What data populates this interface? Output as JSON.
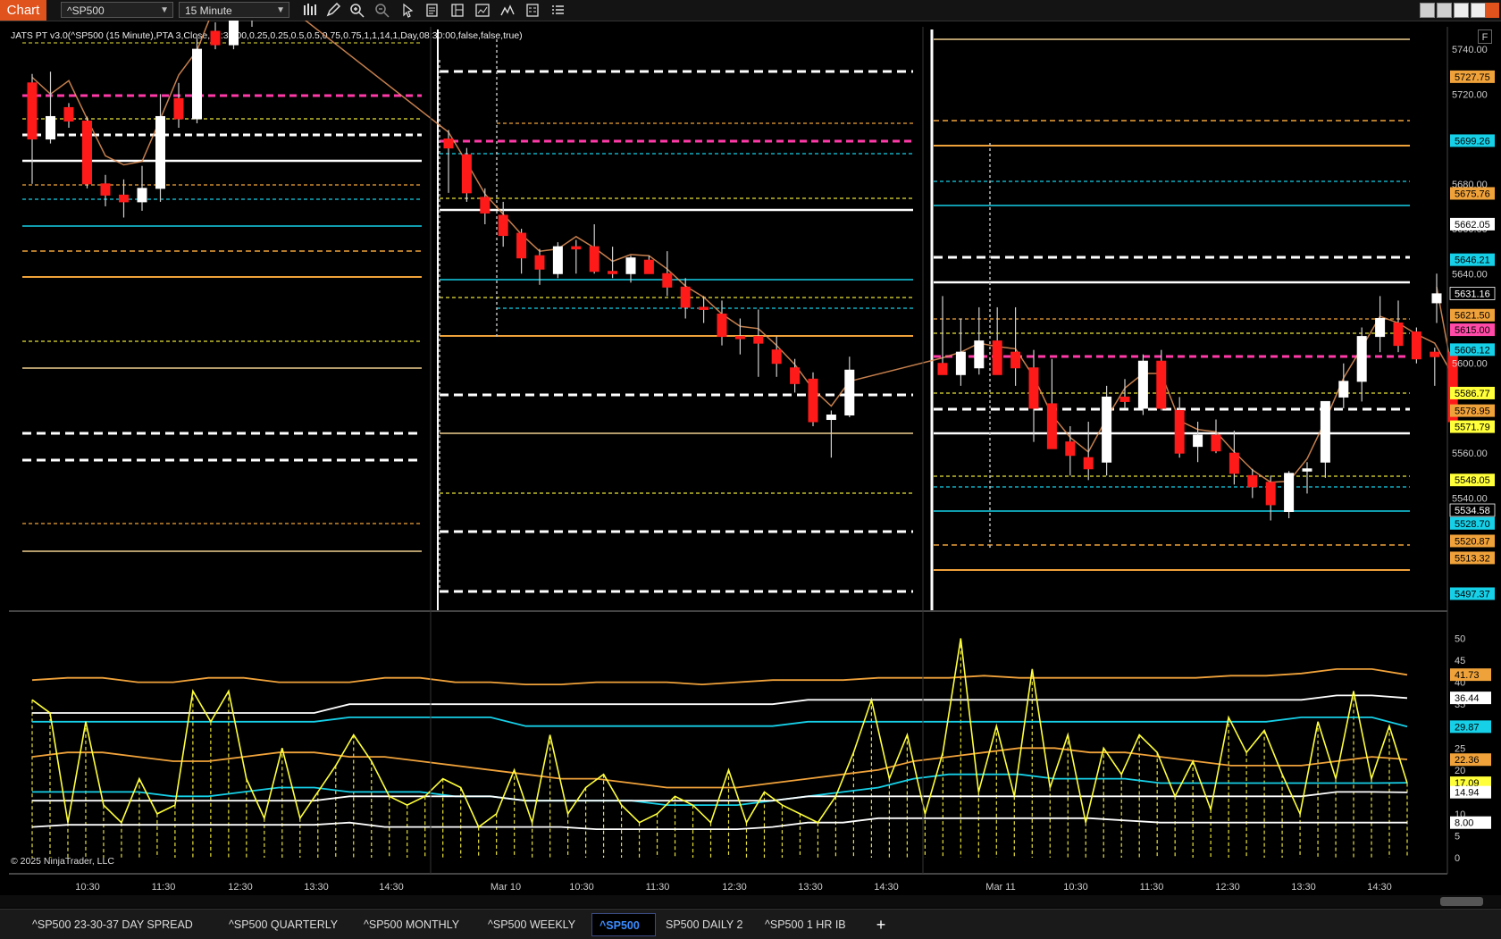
{
  "toolbar": {
    "title": "Chart",
    "instrument": "^SP500",
    "interval": "15 Minute",
    "tools": [
      "bar-type-icon",
      "pencil-icon",
      "zoom-in-icon",
      "zoom-out-icon",
      "pointer-icon",
      "data-box-icon",
      "templates-icon",
      "indicators-icon",
      "strategies-icon",
      "properties-icon",
      "list-icon"
    ]
  },
  "indicator_label": "JATS PT v3.0(^SP500 (15 Minute),PTA 3,Close,09:30:00,0.25,0.25,0.5,0.5,0.75,0.75,1,1,14,1,Day,08:30:00,false,false,true)",
  "f_button": "F",
  "copyright": "© 2025 NinjaTrader, LLC",
  "x_axis_labels": [
    "10:30",
    "11:30",
    "12:30",
    "13:30",
    "14:30",
    "Mar 10",
    "10:30",
    "11:30",
    "12:30",
    "13:30",
    "14:30",
    "Mar 11",
    "10:30",
    "11:30",
    "12:30",
    "13:30",
    "14:30"
  ],
  "price_axis": {
    "ticks": [
      "5740.00",
      "5720.00",
      "5680.00",
      "5660.00",
      "5640.00",
      "5600.00",
      "5560.00",
      "5540.00"
    ],
    "markers": [
      {
        "value": "5727.75",
        "color": "#f0a23a"
      },
      {
        "value": "5699.26",
        "color": "#16d0e8"
      },
      {
        "value": "5675.76",
        "color": "#f0a23a"
      },
      {
        "value": "5662.05",
        "color": "#ffffff"
      },
      {
        "value": "5646.21",
        "color": "#16d0e8"
      },
      {
        "value": "5631.16",
        "color": "#000000"
      },
      {
        "value": "5621.50",
        "color": "#f0a23a"
      },
      {
        "value": "5615.00",
        "color": "#ff4aa8"
      },
      {
        "value": "5606.12",
        "color": "#16d0e8"
      },
      {
        "value": "5586.77",
        "color": "#ffff3a"
      },
      {
        "value": "5578.95",
        "color": "#f0a23a"
      },
      {
        "value": "5571.79",
        "color": "#ffff3a"
      },
      {
        "value": "5548.05",
        "color": "#ffff3a"
      },
      {
        "value": "5534.58",
        "color": "#000000"
      },
      {
        "value": "5528.70",
        "color": "#16d0e8"
      },
      {
        "value": "5520.87",
        "color": "#f0a23a"
      },
      {
        "value": "5513.32",
        "color": "#f0a23a"
      },
      {
        "value": "5497.37",
        "color": "#16d0e8"
      }
    ]
  },
  "lower_axis": {
    "ticks": [
      "50",
      "45",
      "40",
      "35",
      "25",
      "20",
      "15",
      "10",
      "5",
      "0"
    ],
    "markers": [
      {
        "value": "41.73",
        "color": "#f0a23a"
      },
      {
        "value": "36.44",
        "color": "#ffffff"
      },
      {
        "value": "29.87",
        "color": "#16d0e8"
      },
      {
        "value": "22.36",
        "color": "#f0a23a"
      },
      {
        "value": "17.09",
        "color": "#ffff3a"
      },
      {
        "value": "14.94",
        "color": "#ffffff"
      },
      {
        "value": "8.00",
        "color": "#ffffff"
      }
    ]
  },
  "chart_data": {
    "type": "candlestick",
    "instrument": "^SP500",
    "interval": "15 Minute",
    "price_ylim": [
      5490,
      5750
    ],
    "candles": [
      {
        "o": 5725,
        "h": 5729,
        "l": 5680,
        "c": 5700
      },
      {
        "o": 5700,
        "h": 5730,
        "l": 5698,
        "c": 5710
      },
      {
        "o": 5714,
        "h": 5716,
        "l": 5705,
        "c": 5708
      },
      {
        "o": 5708,
        "h": 5710,
        "l": 5678,
        "c": 5680
      },
      {
        "o": 5680,
        "h": 5684,
        "l": 5670,
        "c": 5675
      },
      {
        "o": 5675,
        "h": 5682,
        "l": 5665,
        "c": 5672
      },
      {
        "o": 5672,
        "h": 5688,
        "l": 5668,
        "c": 5678
      },
      {
        "o": 5678,
        "h": 5720,
        "l": 5672,
        "c": 5710
      },
      {
        "o": 5718,
        "h": 5725,
        "l": 5705,
        "c": 5709
      },
      {
        "o": 5709,
        "h": 5745,
        "l": 5707,
        "c": 5740
      },
      {
        "o": 5748,
        "h": 5752,
        "l": 5740,
        "c": 5742
      },
      {
        "o": 5742,
        "h": 5760,
        "l": 5740,
        "c": 5755
      },
      {
        "o": 5755,
        "h": 5760,
        "l": 5750,
        "c": 5758
      },
      {
        "o": 5700,
        "h": 5704,
        "l": 5676,
        "c": 5696
      },
      {
        "o": 5693,
        "h": 5696,
        "l": 5672,
        "c": 5676
      },
      {
        "o": 5674,
        "h": 5678,
        "l": 5662,
        "c": 5667
      },
      {
        "o": 5666,
        "h": 5672,
        "l": 5652,
        "c": 5657
      },
      {
        "o": 5658,
        "h": 5660,
        "l": 5640,
        "c": 5647
      },
      {
        "o": 5648,
        "h": 5651,
        "l": 5635,
        "c": 5642
      },
      {
        "o": 5640,
        "h": 5654,
        "l": 5638,
        "c": 5652
      },
      {
        "o": 5652,
        "h": 5655,
        "l": 5640,
        "c": 5651
      },
      {
        "o": 5652,
        "h": 5662,
        "l": 5640,
        "c": 5641
      },
      {
        "o": 5641,
        "h": 5652,
        "l": 5638,
        "c": 5640
      },
      {
        "o": 5640,
        "h": 5648,
        "l": 5636,
        "c": 5647
      },
      {
        "o": 5646,
        "h": 5648,
        "l": 5640,
        "c": 5640
      },
      {
        "o": 5640,
        "h": 5650,
        "l": 5630,
        "c": 5634
      },
      {
        "o": 5634,
        "h": 5638,
        "l": 5620,
        "c": 5625
      },
      {
        "o": 5625,
        "h": 5630,
        "l": 5618,
        "c": 5624
      },
      {
        "o": 5622,
        "h": 5628,
        "l": 5608,
        "c": 5612
      },
      {
        "o": 5612,
        "h": 5620,
        "l": 5604,
        "c": 5611
      },
      {
        "o": 5612,
        "h": 5624,
        "l": 5594,
        "c": 5609
      },
      {
        "o": 5606,
        "h": 5612,
        "l": 5594,
        "c": 5600
      },
      {
        "o": 5598,
        "h": 5602,
        "l": 5587,
        "c": 5591
      },
      {
        "o": 5593,
        "h": 5596,
        "l": 5572,
        "c": 5574
      },
      {
        "o": 5575,
        "h": 5579,
        "l": 5558,
        "c": 5577
      },
      {
        "o": 5577,
        "h": 5603,
        "l": 5576,
        "c": 5597
      },
      {
        "o": 5600,
        "h": 5630,
        "l": 5595,
        "c": 5595
      },
      {
        "o": 5595,
        "h": 5620,
        "l": 5590,
        "c": 5605
      },
      {
        "o": 5598,
        "h": 5625,
        "l": 5595,
        "c": 5610
      },
      {
        "o": 5610,
        "h": 5625,
        "l": 5600,
        "c": 5595
      },
      {
        "o": 5605,
        "h": 5625,
        "l": 5590,
        "c": 5598
      },
      {
        "o": 5598,
        "h": 5606,
        "l": 5565,
        "c": 5580
      },
      {
        "o": 5582,
        "h": 5602,
        "l": 5562,
        "c": 5562
      },
      {
        "o": 5565,
        "h": 5572,
        "l": 5550,
        "c": 5559
      },
      {
        "o": 5558,
        "h": 5574,
        "l": 5548,
        "c": 5553
      },
      {
        "o": 5556,
        "h": 5590,
        "l": 5550,
        "c": 5585
      },
      {
        "o": 5585,
        "h": 5593,
        "l": 5580,
        "c": 5583
      },
      {
        "o": 5580,
        "h": 5604,
        "l": 5577,
        "c": 5601
      },
      {
        "o": 5601,
        "h": 5606,
        "l": 5579,
        "c": 5580
      },
      {
        "o": 5579,
        "h": 5585,
        "l": 5558,
        "c": 5560
      },
      {
        "o": 5563,
        "h": 5574,
        "l": 5556,
        "c": 5568
      },
      {
        "o": 5568,
        "h": 5575,
        "l": 5560,
        "c": 5561
      },
      {
        "o": 5560,
        "h": 5570,
        "l": 5546,
        "c": 5551
      },
      {
        "o": 5550,
        "h": 5553,
        "l": 5540,
        "c": 5545
      },
      {
        "o": 5547,
        "h": 5550,
        "l": 5530,
        "c": 5537
      },
      {
        "o": 5534,
        "h": 5552,
        "l": 5531,
        "c": 5551
      },
      {
        "o": 5552,
        "h": 5556,
        "l": 5542,
        "c": 5553
      },
      {
        "o": 5556,
        "h": 5583,
        "l": 5549,
        "c": 5583
      },
      {
        "o": 5585,
        "h": 5600,
        "l": 5580,
        "c": 5592
      },
      {
        "o": 5592,
        "h": 5616,
        "l": 5583,
        "c": 5612
      },
      {
        "o": 5612,
        "h": 5630,
        "l": 5605,
        "c": 5620
      },
      {
        "o": 5618,
        "h": 5628,
        "l": 5605,
        "c": 5608
      },
      {
        "o": 5614,
        "h": 5616,
        "l": 5600,
        "c": 5602
      },
      {
        "o": 5605,
        "h": 5607,
        "l": 5590,
        "c": 5603
      },
      {
        "o": 5605,
        "h": 5608,
        "l": 5570,
        "c": 5574
      },
      {
        "o": 5627,
        "h": 5640,
        "l": 5618,
        "c": 5631
      }
    ],
    "lower_ylim": [
      0,
      55
    ],
    "lower_series": [
      {
        "color": "#ffff3a",
        "values": [
          36,
          33,
          8,
          31,
          12,
          8,
          18,
          10,
          12,
          38,
          31,
          38,
          18,
          9,
          25,
          9,
          15,
          21,
          28,
          22,
          14,
          12,
          14,
          18,
          16,
          7,
          10,
          20,
          8,
          28,
          10,
          16,
          19,
          12,
          8,
          10,
          14,
          12,
          8,
          20,
          8,
          15,
          12,
          10,
          8,
          14,
          24,
          36,
          18,
          28,
          10,
          24,
          50,
          15,
          30,
          14,
          43,
          16,
          28,
          8,
          25,
          19,
          28,
          24,
          14,
          22,
          11,
          32,
          24,
          29,
          19,
          10,
          31,
          18,
          38,
          18,
          30,
          17
        ]
      }
    ],
    "legend_values": [
      "41.73",
      "36.44",
      "29.87",
      "22.36",
      "17.09",
      "14.94",
      "8.00"
    ]
  },
  "tabs": [
    {
      "label": "^SP500 23-30-37 DAY SPREAD",
      "active": false
    },
    {
      "label": "^SP500 QUARTERLY",
      "active": false
    },
    {
      "label": "^SP500 MONTHLY",
      "active": false
    },
    {
      "label": "^SP500 WEEKLY",
      "active": false
    },
    {
      "label": "^SP500",
      "active": true
    },
    {
      "label": "SP500 DAILY 2",
      "active": false
    },
    {
      "label": "^SP500 1 HR IB",
      "active": false
    }
  ],
  "add_tab": "+"
}
